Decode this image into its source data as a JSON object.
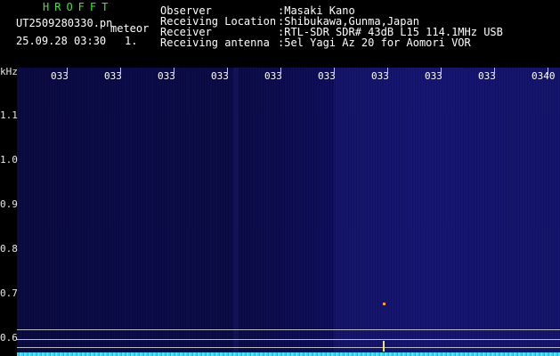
{
  "header": {
    "brand": "HROFFT",
    "filename": "UT2509280330.pn",
    "meteor_label": "meteor",
    "datetime": "25.09.28 03:30",
    "count": "1.",
    "observer_label": "Observer",
    "observer_value": ":Masaki Kano",
    "location_label": "Receiving Location",
    "location_value": ":Shibukawa,Gunma,Japan",
    "receiver_label": "Receiver",
    "receiver_value": ":RTL-SDR SDR# 43dB L15 114.1MHz USB",
    "antenna_label": "Receiving antenna",
    "antenna_value": ":5el Yagi Az 20 for Aomori VOR"
  },
  "axis": {
    "unit": "kHz",
    "y_ticks": [
      "1.1",
      "1.0",
      "0.9",
      "0.8",
      "0.7",
      "0.6"
    ],
    "x_ticks": [
      "033",
      "033",
      "033",
      "033",
      "033",
      "033",
      "033",
      "033",
      "033",
      "0340"
    ]
  },
  "colors": {
    "accent_green": "#3ce83c",
    "baseline_cyan": "#37d3f3",
    "signal_yellow": "#f1e46a"
  }
}
